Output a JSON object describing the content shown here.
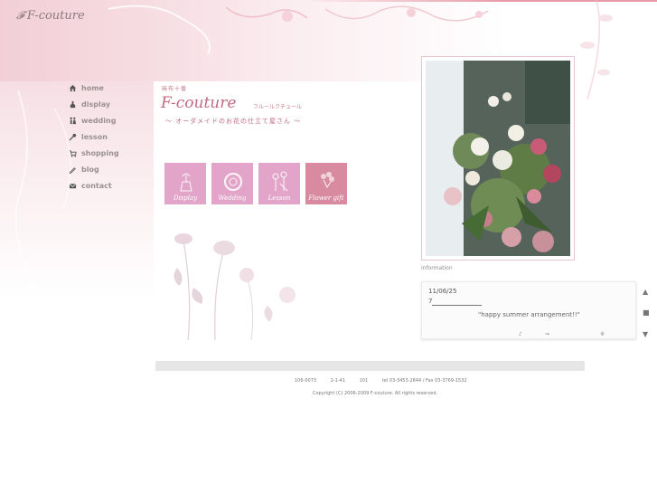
{
  "logo": {
    "mark": "𝓕",
    "text": "F-couture"
  },
  "nav": [
    {
      "icon": "home-icon",
      "label": "home"
    },
    {
      "icon": "display-icon",
      "label": "display"
    },
    {
      "icon": "wedding-icon",
      "label": "wedding"
    },
    {
      "icon": "lesson-icon",
      "label": "lesson"
    },
    {
      "icon": "cart-icon",
      "label": "shopping"
    },
    {
      "icon": "pen-icon",
      "label": "blog"
    },
    {
      "icon": "mail-icon",
      "label": "contact"
    }
  ],
  "brand": {
    "sub": "麻布十番",
    "title": "F-couture",
    "kana": "フルールクチュール",
    "tagline": "～ オーダメイドのお花の仕立て屋さん ～"
  },
  "tiles": [
    {
      "label": "Display",
      "color": "#e2a5c9"
    },
    {
      "label": "Wedding",
      "color": "#e2a5c9"
    },
    {
      "label": "Lesson",
      "color": "#e2a5c9"
    },
    {
      "label": "Flower gift",
      "color": "#d88ba0"
    }
  ],
  "information": {
    "heading": "information",
    "date": "11/06/25",
    "link": "7",
    "text": "\"happy summer arrangement!!\"",
    "dots": "˙   ˙",
    "controls": [
      "♪",
      "⇒",
      "※"
    ]
  },
  "scroll": [
    "▲",
    "■",
    "▼"
  ],
  "footer": {
    "address": [
      "106-0073",
      "2-1-41",
      "101",
      "tel 03-3453-2844 / Fax 03-3769-1532"
    ],
    "copyright": "Copyright (C) 2006-2009 F-couture. All rights reserved."
  }
}
